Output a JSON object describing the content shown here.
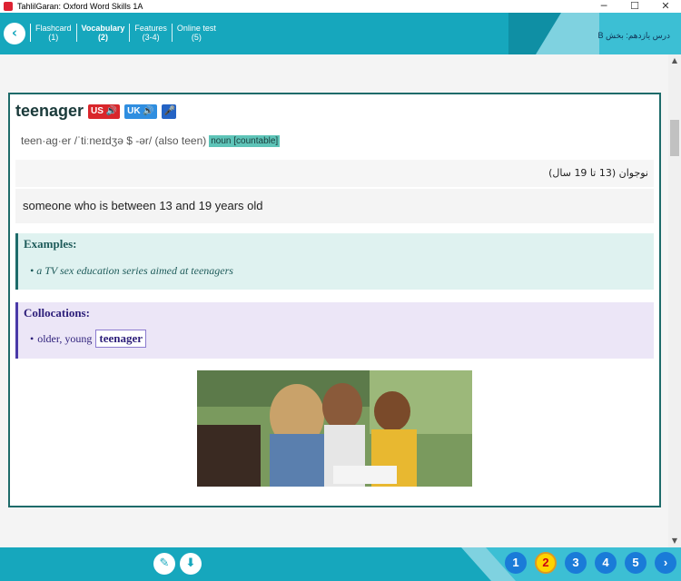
{
  "window": {
    "title": "TahlilGaran: Oxford Word Skills 1A",
    "minimize": "─",
    "maximize": "☐",
    "close": "✕"
  },
  "header": {
    "back_icon": "‹",
    "tabs": [
      {
        "label": "Flashcard",
        "sub": "(1)"
      },
      {
        "label": "Vocabulary",
        "sub": "(2)"
      },
      {
        "label": "Features",
        "sub": "(3-4)"
      },
      {
        "label": "Online test",
        "sub": "(5)"
      }
    ],
    "lesson": "درس یازدهم: بخش B"
  },
  "entry": {
    "word": "teenager",
    "us_label": "US 🔊",
    "uk_label": "UK 🔊",
    "mic_icon": "🎤",
    "pronunciation": "teen·ag·er /ˈtiːneɪdʒə $ -ər/ (also teen)",
    "pos": "noun [countable]",
    "persian": "نوجوان (13 تا 19 سال)",
    "definition": "someone who is between 13 and 19 years old",
    "examples_title": "Examples:",
    "example": "a TV sex education series aimed at teenagers",
    "collocations_title": "Collocations:",
    "collocation_prefix": "older, young",
    "collocation_word": "teenager"
  },
  "footer": {
    "edit_icon": "✎",
    "download_icon": "⬇",
    "pages": [
      "1",
      "2",
      "3",
      "4",
      "5"
    ],
    "active_page": "2",
    "next_icon": "›"
  }
}
